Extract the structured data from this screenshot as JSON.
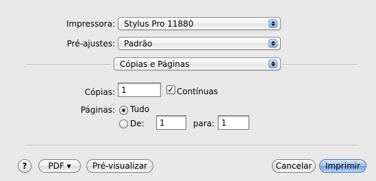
{
  "printer": {
    "label": "Impressora:",
    "value": "Stylus Pro 11880"
  },
  "presets": {
    "label": "Pré-ajustes:",
    "value": "Padrão"
  },
  "section": {
    "value": "Cópias e Páginas"
  },
  "copies": {
    "label": "Cópias:",
    "value": "1",
    "collated_label": "Contínuas",
    "collated_checked": true
  },
  "pages": {
    "label": "Páginas:",
    "all_label": "Tudo",
    "from_label": "De:",
    "from_value": "1",
    "to_label": "para:",
    "to_value": "1",
    "selected": "all"
  },
  "footer": {
    "help": "?",
    "pdf": "PDF ▾",
    "preview": "Pré-visualizar",
    "cancel": "Cancelar",
    "print": "Imprimir"
  }
}
